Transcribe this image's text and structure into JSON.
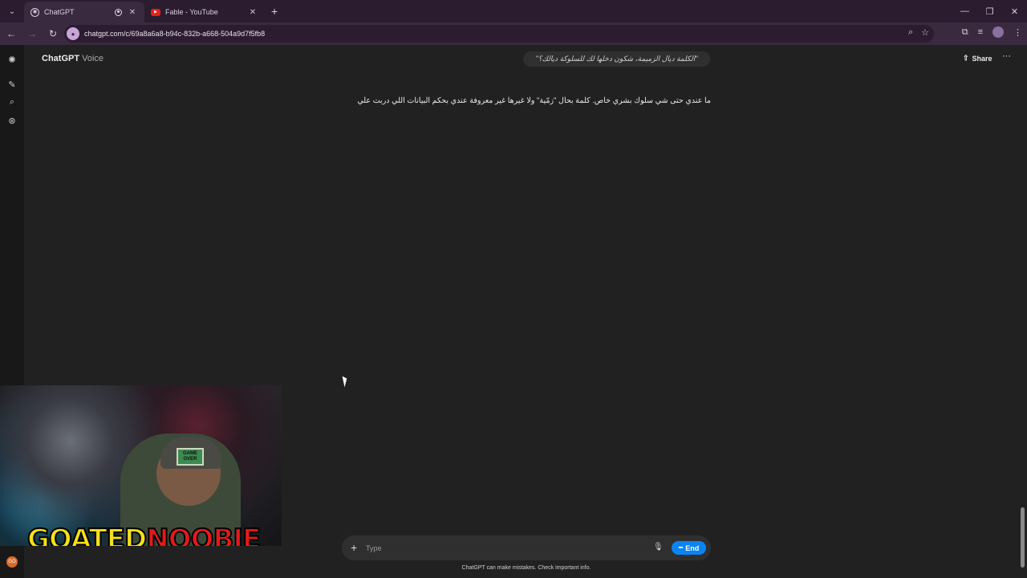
{
  "browser": {
    "tabs": [
      {
        "title": "ChatGPT",
        "active": true
      },
      {
        "title": "Fable - YouTube",
        "active": false
      }
    ],
    "url": "chatgpt.com/c/69a8a6a8-b94c-832b-a668-504a9d7f5fb8"
  },
  "header": {
    "app_name": "ChatGPT",
    "mode": "Voice",
    "share_label": "Share"
  },
  "conversation": {
    "user_message": "\"الكلمة ديال الزميمة، شكون دخلها لك للسلوكة ديالك؟\"",
    "assistant_message": "ما عندي حتى شي سلوك بشري خاص. كلمة بحال \"زمّية\" ولا غيرها غير معروفة عندي بحكم البيانات اللي دربت علي"
  },
  "composer": {
    "placeholder": "Type",
    "end_label": "End",
    "disclaimer": "ChatGPT can make mistakes. Check important info."
  },
  "webcam": {
    "logo_part1": "GOATED",
    "logo_part2": "NOOBIE",
    "cap_text": "GAME OVER"
  },
  "colors": {
    "accent": "#0b84f3",
    "background": "#212121"
  }
}
